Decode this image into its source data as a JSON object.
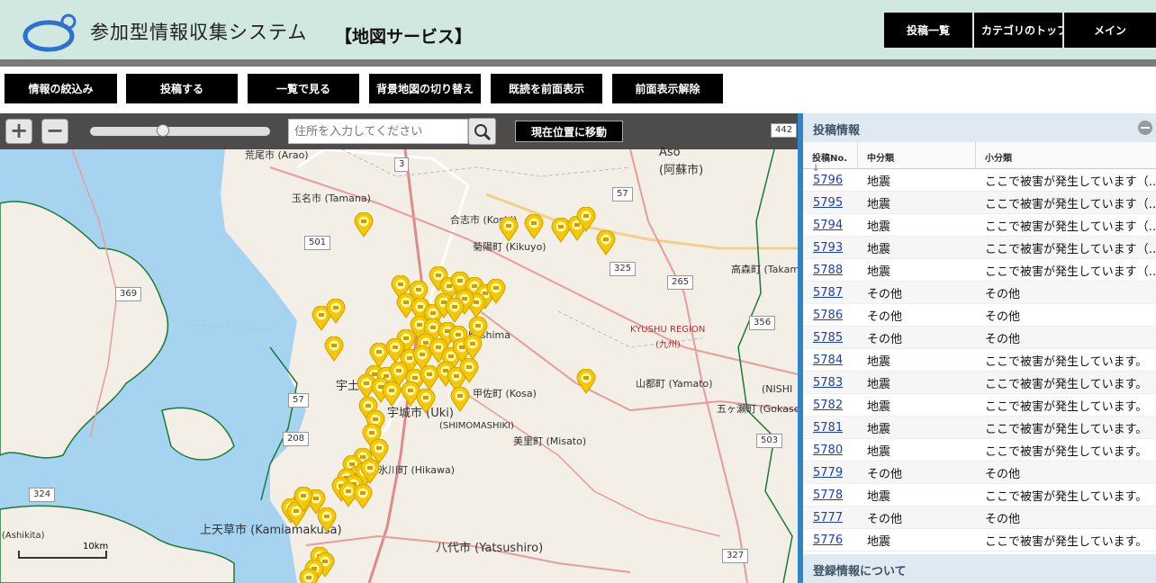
{
  "header": {
    "app_title": "参加型情報収集システム",
    "service_title": "【地図サービス】",
    "nav": [
      "投稿一覧",
      "カテゴリのトップ",
      "メイン"
    ]
  },
  "toolbar": {
    "buttons": [
      "情報の絞込み",
      "投稿する",
      "一覧で見る",
      "背景地図の切り替え",
      "既読を前面表示",
      "前面表示解除"
    ]
  },
  "map": {
    "search_placeholder": "住所を入力してください",
    "locate_label": "現在位置に移動",
    "scale_label": "10km",
    "place_labels": [
      "荒尾市 (Arao)",
      "玉名市 (Tamana)",
      "合志市 (Koshi)",
      "菊陽町 (Kikuyo)",
      "Aso",
      "(阿蘇市)",
      "高森町 (Takamori)",
      "Kashima",
      "KYUSHU REGION",
      "(九州)",
      "宇土",
      "宇城市 (Uki)",
      "(SHIMOMASHIKI)",
      "甲佐町 (Kosa)",
      "美里町 (Misato)",
      "山都町 (Yamato)",
      "(NISHI",
      "五ヶ瀬町 (Gokase",
      "氷川町 (Hikawa)",
      "上天草市 (Kamiamakusa)",
      "八代市 (Yatsushiro)",
      "(Ashikita)"
    ],
    "route_numbers": [
      "442",
      "3",
      "57",
      "501",
      "325",
      "265",
      "369",
      "356",
      "57",
      "208",
      "503",
      "324",
      "327"
    ]
  },
  "panel": {
    "title": "投稿情報",
    "columns": [
      "投稿No.",
      "中分類",
      "小分類"
    ],
    "rows": [
      {
        "no": "5796",
        "mid": "地震",
        "sub": "ここで被害が発生しています（…"
      },
      {
        "no": "5795",
        "mid": "地震",
        "sub": "ここで被害が発生しています（…"
      },
      {
        "no": "5794",
        "mid": "地震",
        "sub": "ここで被害が発生しています（…"
      },
      {
        "no": "5793",
        "mid": "地震",
        "sub": "ここで被害が発生しています（…"
      },
      {
        "no": "5788",
        "mid": "地震",
        "sub": "ここで被害が発生しています（…"
      },
      {
        "no": "5787",
        "mid": "その他",
        "sub": "その他"
      },
      {
        "no": "5786",
        "mid": "その他",
        "sub": "その他"
      },
      {
        "no": "5785",
        "mid": "その他",
        "sub": "その他"
      },
      {
        "no": "5784",
        "mid": "地震",
        "sub": "ここで被害が発生しています。"
      },
      {
        "no": "5783",
        "mid": "地震",
        "sub": "ここで被害が発生しています。"
      },
      {
        "no": "5782",
        "mid": "地震",
        "sub": "ここで被害が発生しています。"
      },
      {
        "no": "5781",
        "mid": "地震",
        "sub": "ここで被害が発生しています。"
      },
      {
        "no": "5780",
        "mid": "地震",
        "sub": "ここで被害が発生しています。"
      },
      {
        "no": "5779",
        "mid": "その他",
        "sub": "その他"
      },
      {
        "no": "5778",
        "mid": "地震",
        "sub": "ここで被害が発生しています。"
      },
      {
        "no": "5777",
        "mid": "その他",
        "sub": "その他"
      },
      {
        "no": "5776",
        "mid": "地震",
        "sub": "ここで被害が発生しています。"
      }
    ],
    "footer": "登録情報について"
  }
}
